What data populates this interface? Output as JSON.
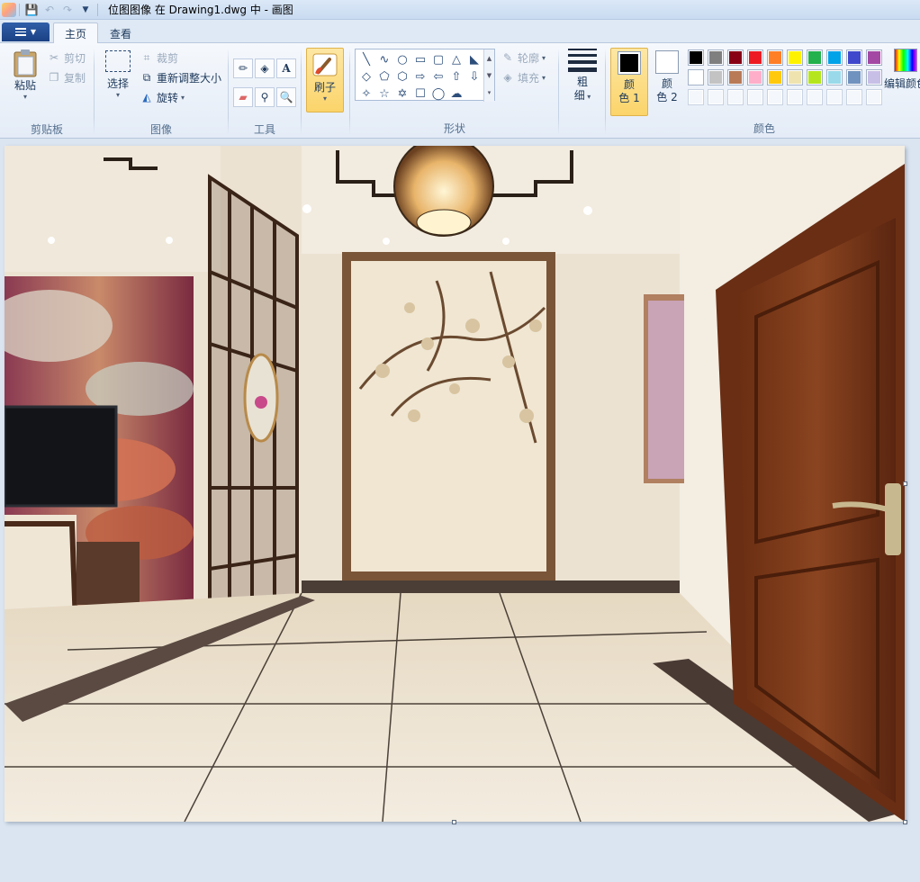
{
  "window": {
    "title": "位图图像 在 Drawing1.dwg 中 - 画图"
  },
  "tabs": [
    {
      "label": "主页",
      "active": true
    },
    {
      "label": "查看",
      "active": false
    }
  ],
  "groups": {
    "clipboard": {
      "label": "剪贴板",
      "paste": "粘贴",
      "cut": "剪切",
      "copy": "复制"
    },
    "image": {
      "label": "图像",
      "select": "选择",
      "crop": "裁剪",
      "resize": "重新调整大小",
      "rotate": "旋转"
    },
    "tools": {
      "label": "工具",
      "text_glyph": "A"
    },
    "brushes": {
      "label": "刷子"
    },
    "shapes": {
      "label": "形状",
      "outline": "轮廓",
      "fill": "填充"
    },
    "size": {
      "label_line1": "粗",
      "label_line2": "细"
    },
    "colors": {
      "label": "颜色",
      "color1_line1": "颜",
      "color1_line2": "色 1",
      "color2_line1": "颜",
      "color2_line2": "色 2",
      "color1_value": "#000000",
      "color2_value": "#ffffff",
      "edit_colors": "编辑颜色",
      "palette_row1": [
        "#000000",
        "#7f7f7f",
        "#880015",
        "#ed1c24",
        "#ff7f27",
        "#fff200",
        "#22b14c",
        "#00a2e8",
        "#3f48cc",
        "#a349a4"
      ],
      "palette_row2": [
        "#ffffff",
        "#c3c3c3",
        "#b97a57",
        "#ffaec9",
        "#ffc90e",
        "#efe4b0",
        "#b5e61d",
        "#99d9ea",
        "#7092be",
        "#c8bfe7"
      ],
      "palette_row3": [
        "#ffffff",
        "#ffffff",
        "#ffffff",
        "#ffffff",
        "#ffffff",
        "#ffffff",
        "#ffffff",
        "#ffffff",
        "#ffffff",
        "#ffffff"
      ]
    }
  },
  "shape_icons": [
    "╲",
    "∿",
    "○",
    "▭",
    "▢",
    "△",
    "◣",
    "◇",
    "⬠",
    "⬡",
    "⇨",
    "⇦",
    "⇧",
    "⇩",
    "✧",
    "☆",
    "✡",
    "☐",
    "◯",
    "☁"
  ]
}
